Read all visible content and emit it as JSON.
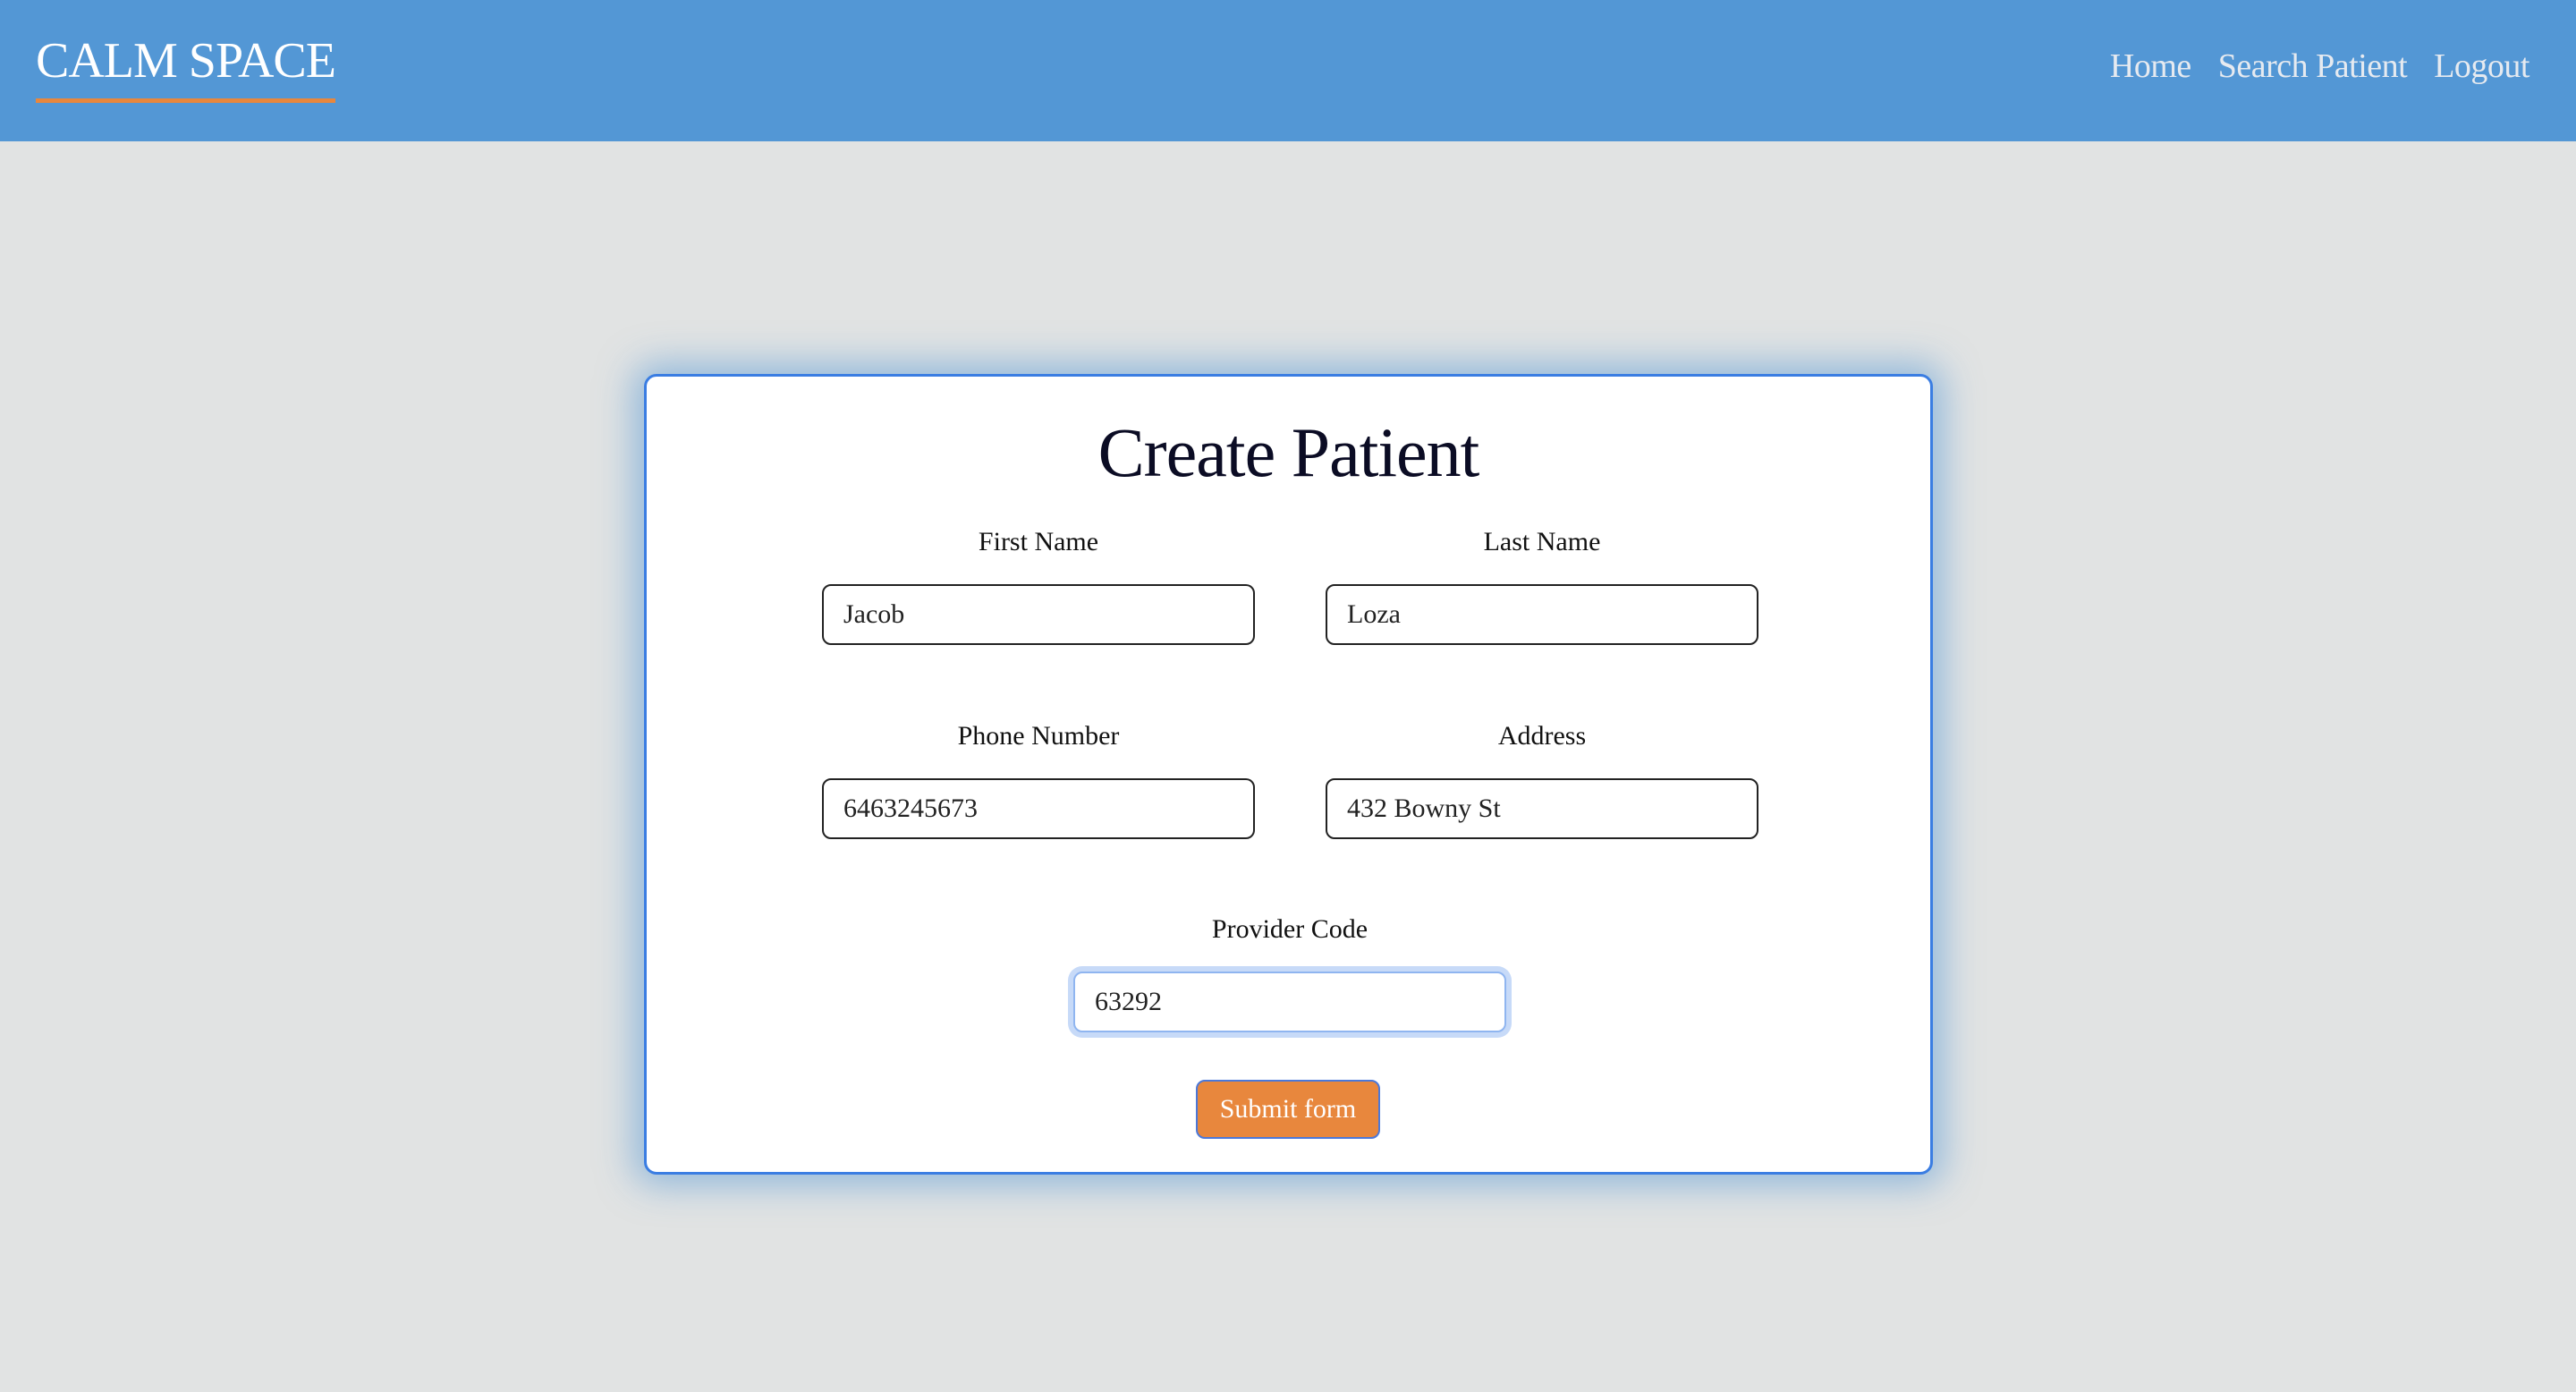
{
  "header": {
    "brand": "CALM SPACE",
    "nav": [
      {
        "label": "Home"
      },
      {
        "label": "Search Patient"
      },
      {
        "label": "Logout"
      }
    ],
    "colors": {
      "header_bg": "#5397d5",
      "brand_underline": "#e8873d"
    }
  },
  "form": {
    "title": "Create Patient",
    "fields": [
      {
        "label": "First Name",
        "value": "Jacob"
      },
      {
        "label": "Last Name",
        "value": "Loza"
      },
      {
        "label": "Phone Number",
        "value": "6463245673"
      },
      {
        "label": "Address",
        "value": "432 Bowny St"
      },
      {
        "label": "Provider Code",
        "value": "63292",
        "focused": true
      }
    ],
    "submit_label": "Submit form",
    "colors": {
      "card_border": "#3a7de2",
      "submit_bg": "#e8873d"
    }
  }
}
